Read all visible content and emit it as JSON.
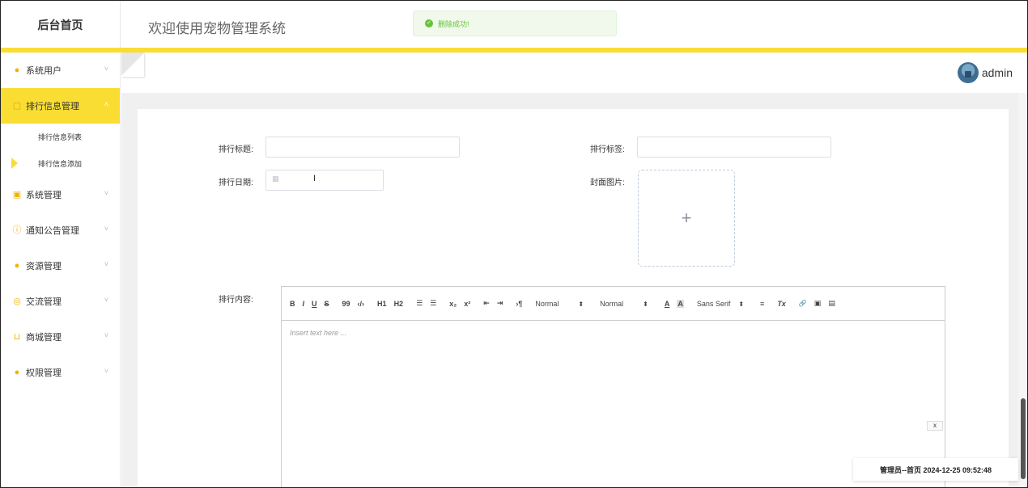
{
  "header": {
    "logo": "后台首页",
    "title": "欢迎使用宠物管理系统"
  },
  "toast": {
    "message": "删除成功!"
  },
  "user": {
    "name": "admin"
  },
  "sidebar": {
    "items": [
      {
        "label": "系统用户",
        "icon": "user-icon"
      },
      {
        "label": "排行信息管理",
        "icon": "note-icon",
        "active": true,
        "children": [
          {
            "label": "排行信息列表"
          },
          {
            "label": "排行信息添加",
            "current": true
          }
        ]
      },
      {
        "label": "系统管理",
        "icon": "image-icon"
      },
      {
        "label": "通知公告管理",
        "icon": "info-icon"
      },
      {
        "label": "资源管理",
        "icon": "location-icon"
      },
      {
        "label": "交流管理",
        "icon": "chat-icon"
      },
      {
        "label": "商城管理",
        "icon": "cart-icon"
      },
      {
        "label": "权限管理",
        "icon": "user-icon"
      }
    ]
  },
  "form": {
    "title_label": "排行标题:",
    "tag_label": "排行标签:",
    "date_label": "排行日期:",
    "cover_label": "封面图片:",
    "content_label": "排行内容:",
    "upload_plus": "+",
    "editor_placeholder": "Insert text here ..."
  },
  "editor": {
    "toolbar": {
      "bold": "B",
      "italic": "I",
      "underline": "U",
      "strike": "S",
      "quote": "99",
      "code": "‹/›",
      "h1": "H1",
      "h2": "H2",
      "ol": "☰",
      "ul": "☰",
      "sub": "x₂",
      "sup": "x²",
      "outdent": "⇤",
      "indent": "⇥",
      "direction": "›¶",
      "size": "Normal",
      "header": "Normal",
      "color": "A",
      "background": "A",
      "font": "Sans Serif",
      "align": "≡",
      "clean": "Tx",
      "link": "🔗",
      "image": "▣",
      "video": "▤"
    },
    "close_label": "x"
  },
  "status": {
    "text": "管理员--首页 2024-12-25 09:52:48"
  },
  "colors": {
    "accent": "#f9dd33",
    "success": "#67c23a"
  }
}
